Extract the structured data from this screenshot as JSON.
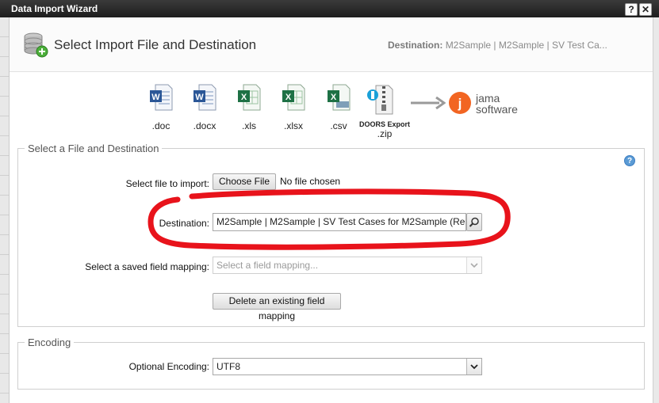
{
  "window": {
    "title": "Data Import Wizard",
    "help_glyph": "?",
    "close_glyph": "✕"
  },
  "header": {
    "title": "Select Import File and Destination",
    "destination_label": "Destination:",
    "destination_value": "M2Sample | M2Sample | SV Test Ca..."
  },
  "file_types": [
    {
      "label": ".doc",
      "icon": "word-doc-icon",
      "color": "#2b5797"
    },
    {
      "label": ".docx",
      "icon": "word-docx-icon",
      "color": "#2b5797"
    },
    {
      "label": ".xls",
      "icon": "excel-xls-icon",
      "color": "#1e7145"
    },
    {
      "label": ".xlsx",
      "icon": "excel-xlsx-icon",
      "color": "#1e7145"
    },
    {
      "label": ".csv",
      "icon": "excel-csv-icon",
      "color": "#1e7145"
    }
  ],
  "doors": {
    "label_top": "DOORS Export",
    "label_bottom": ".zip",
    "icon": "zip-archive-icon"
  },
  "logo": {
    "letter": "j",
    "line1": "jama",
    "line2": "software",
    "accent": "#f26522"
  },
  "file_section": {
    "legend": "Select a File and Destination",
    "help_glyph": "?",
    "select_file_label": "Select file to import:",
    "choose_file_button": "Choose File",
    "no_file_text": "No file chosen",
    "destination_label": "Destination:",
    "destination_value": "M2Sample | M2Sample | SV Test Cases for M2Sample (Re",
    "mapping_label": "Select a saved field mapping:",
    "mapping_placeholder": "Select a field mapping...",
    "delete_mapping_button": "Delete an existing field mapping"
  },
  "encoding_section": {
    "legend": "Encoding",
    "label": "Optional Encoding:",
    "value": "UTF8"
  },
  "colors": {
    "annotation_red": "#e8131b",
    "help_blue": "#5b9bd5"
  }
}
